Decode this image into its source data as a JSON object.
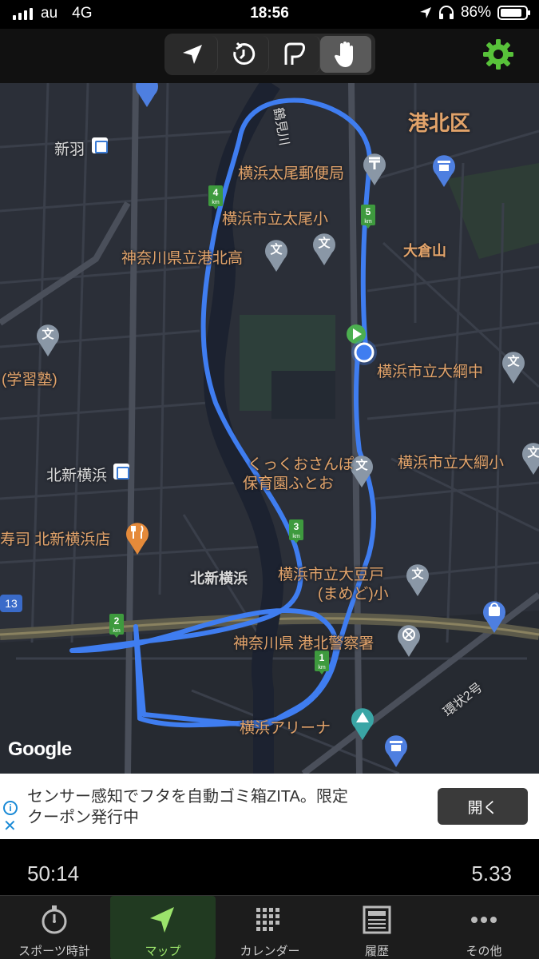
{
  "status": {
    "carrier": "au",
    "network": "4G",
    "time": "18:56",
    "battery": "86%",
    "battery_level": 0.86
  },
  "toolbar": {
    "buttons": [
      {
        "icon": "location-arrow-icon",
        "active": false
      },
      {
        "icon": "history-clock-icon",
        "active": false
      },
      {
        "icon": "route-icon",
        "active": false
      },
      {
        "icon": "hand-icon",
        "active": true
      }
    ],
    "settings_icon": "gear-icon",
    "accent": "#58c23a"
  },
  "map": {
    "labels": [
      {
        "id": "kohoku-ward",
        "text": "港北区"
      },
      {
        "id": "shinba",
        "text": "新羽"
      },
      {
        "id": "yokohama-oo-post",
        "text": "横浜太尾郵便局"
      },
      {
        "id": "yokohama-oo-elem",
        "text": "横浜市立太尾小"
      },
      {
        "id": "kanagawa-kohoku-high",
        "text": "神奈川県立港北高"
      },
      {
        "id": "okurayama",
        "text": "大倉山"
      },
      {
        "id": "gakushujuku",
        "text": "(学習塾)"
      },
      {
        "id": "tsunashima-mid",
        "text": "横浜市立大綱中"
      },
      {
        "id": "kitashinyokohama-stn",
        "text": "北新横浜"
      },
      {
        "id": "kukku-line1",
        "text": "くっくおさんぽ"
      },
      {
        "id": "kukku-line2",
        "text": "保育園ふとお"
      },
      {
        "id": "tsunashima-elem",
        "text": "横浜市立大綱小"
      },
      {
        "id": "sushi",
        "text": "寿司 北新横浜店"
      },
      {
        "id": "kitashinyokohama-area",
        "text": "北新横浜"
      },
      {
        "id": "mamedo-line1",
        "text": "横浜市立大豆戸"
      },
      {
        "id": "mamedo-line2",
        "text": "(まめど)小"
      },
      {
        "id": "kohoku-police",
        "text": "神奈川県 港北警察署"
      },
      {
        "id": "route-13",
        "text": "13"
      },
      {
        "id": "kanjo2",
        "text": "環状2号"
      },
      {
        "id": "yokohama-arena",
        "text": "横浜アリーナ"
      },
      {
        "id": "tsurumi-river",
        "text": "鶴見川"
      }
    ],
    "km_markers": [
      "1",
      "2",
      "3",
      "4",
      "5"
    ],
    "km_unit": "km",
    "route_color": "#3f7df0",
    "google_logo": "Google"
  },
  "ad": {
    "text_line1": "センサー感知でフタを自動ゴミ箱ZITA。限定",
    "text_line2": "クーポン発行中",
    "open_label": "開く",
    "info_icon": "i",
    "close_icon": "✕"
  },
  "stats": {
    "elapsed": "50:14",
    "distance": "5.33"
  },
  "tabs": [
    {
      "label": "スポーツ時計",
      "icon": "stopwatch-icon",
      "active": false
    },
    {
      "label": "マップ",
      "icon": "map-arrow-icon",
      "active": true
    },
    {
      "label": "カレンダー",
      "icon": "calendar-grid-icon",
      "active": false
    },
    {
      "label": "履歴",
      "icon": "history-list-icon",
      "active": false
    },
    {
      "label": "その他",
      "icon": "more-icon",
      "active": false
    }
  ]
}
